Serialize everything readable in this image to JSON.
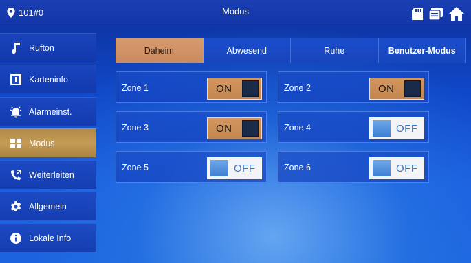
{
  "header": {
    "room": "101#0",
    "title": "Modus",
    "icons": [
      "sd-card-icon",
      "message-icon",
      "home-icon"
    ]
  },
  "sidebar": {
    "items": [
      {
        "label": "Rufton",
        "icon": "music-note-icon",
        "active": false
      },
      {
        "label": "Karteninfo",
        "icon": "card-info-icon",
        "active": false
      },
      {
        "label": "Alarmeinst.",
        "icon": "alarm-bell-icon",
        "active": false
      },
      {
        "label": "Modus",
        "icon": "mode-grid-icon",
        "active": true
      },
      {
        "label": "Weiterleiten",
        "icon": "call-forward-icon",
        "active": false
      },
      {
        "label": "Allgemein",
        "icon": "gear-icon",
        "active": false
      },
      {
        "label": "Lokale Info",
        "icon": "info-icon",
        "active": false
      }
    ]
  },
  "tabs": [
    {
      "label": "Daheim",
      "active": true
    },
    {
      "label": "Abwesend",
      "active": false
    },
    {
      "label": "Ruhe",
      "active": false
    },
    {
      "label": "Benutzer-Modus",
      "active": false
    }
  ],
  "zones": [
    {
      "label": "Zone 1",
      "state": "ON"
    },
    {
      "label": "Zone 2",
      "state": "ON"
    },
    {
      "label": "Zone 3",
      "state": "ON"
    },
    {
      "label": "Zone 4",
      "state": "OFF"
    },
    {
      "label": "Zone 5",
      "state": "OFF"
    },
    {
      "label": "Zone 6",
      "state": "OFF"
    }
  ],
  "colors": {
    "active_orange": "#d79a6e",
    "sidebar_active": "#c59b55",
    "background_blue": "#1048c8"
  }
}
